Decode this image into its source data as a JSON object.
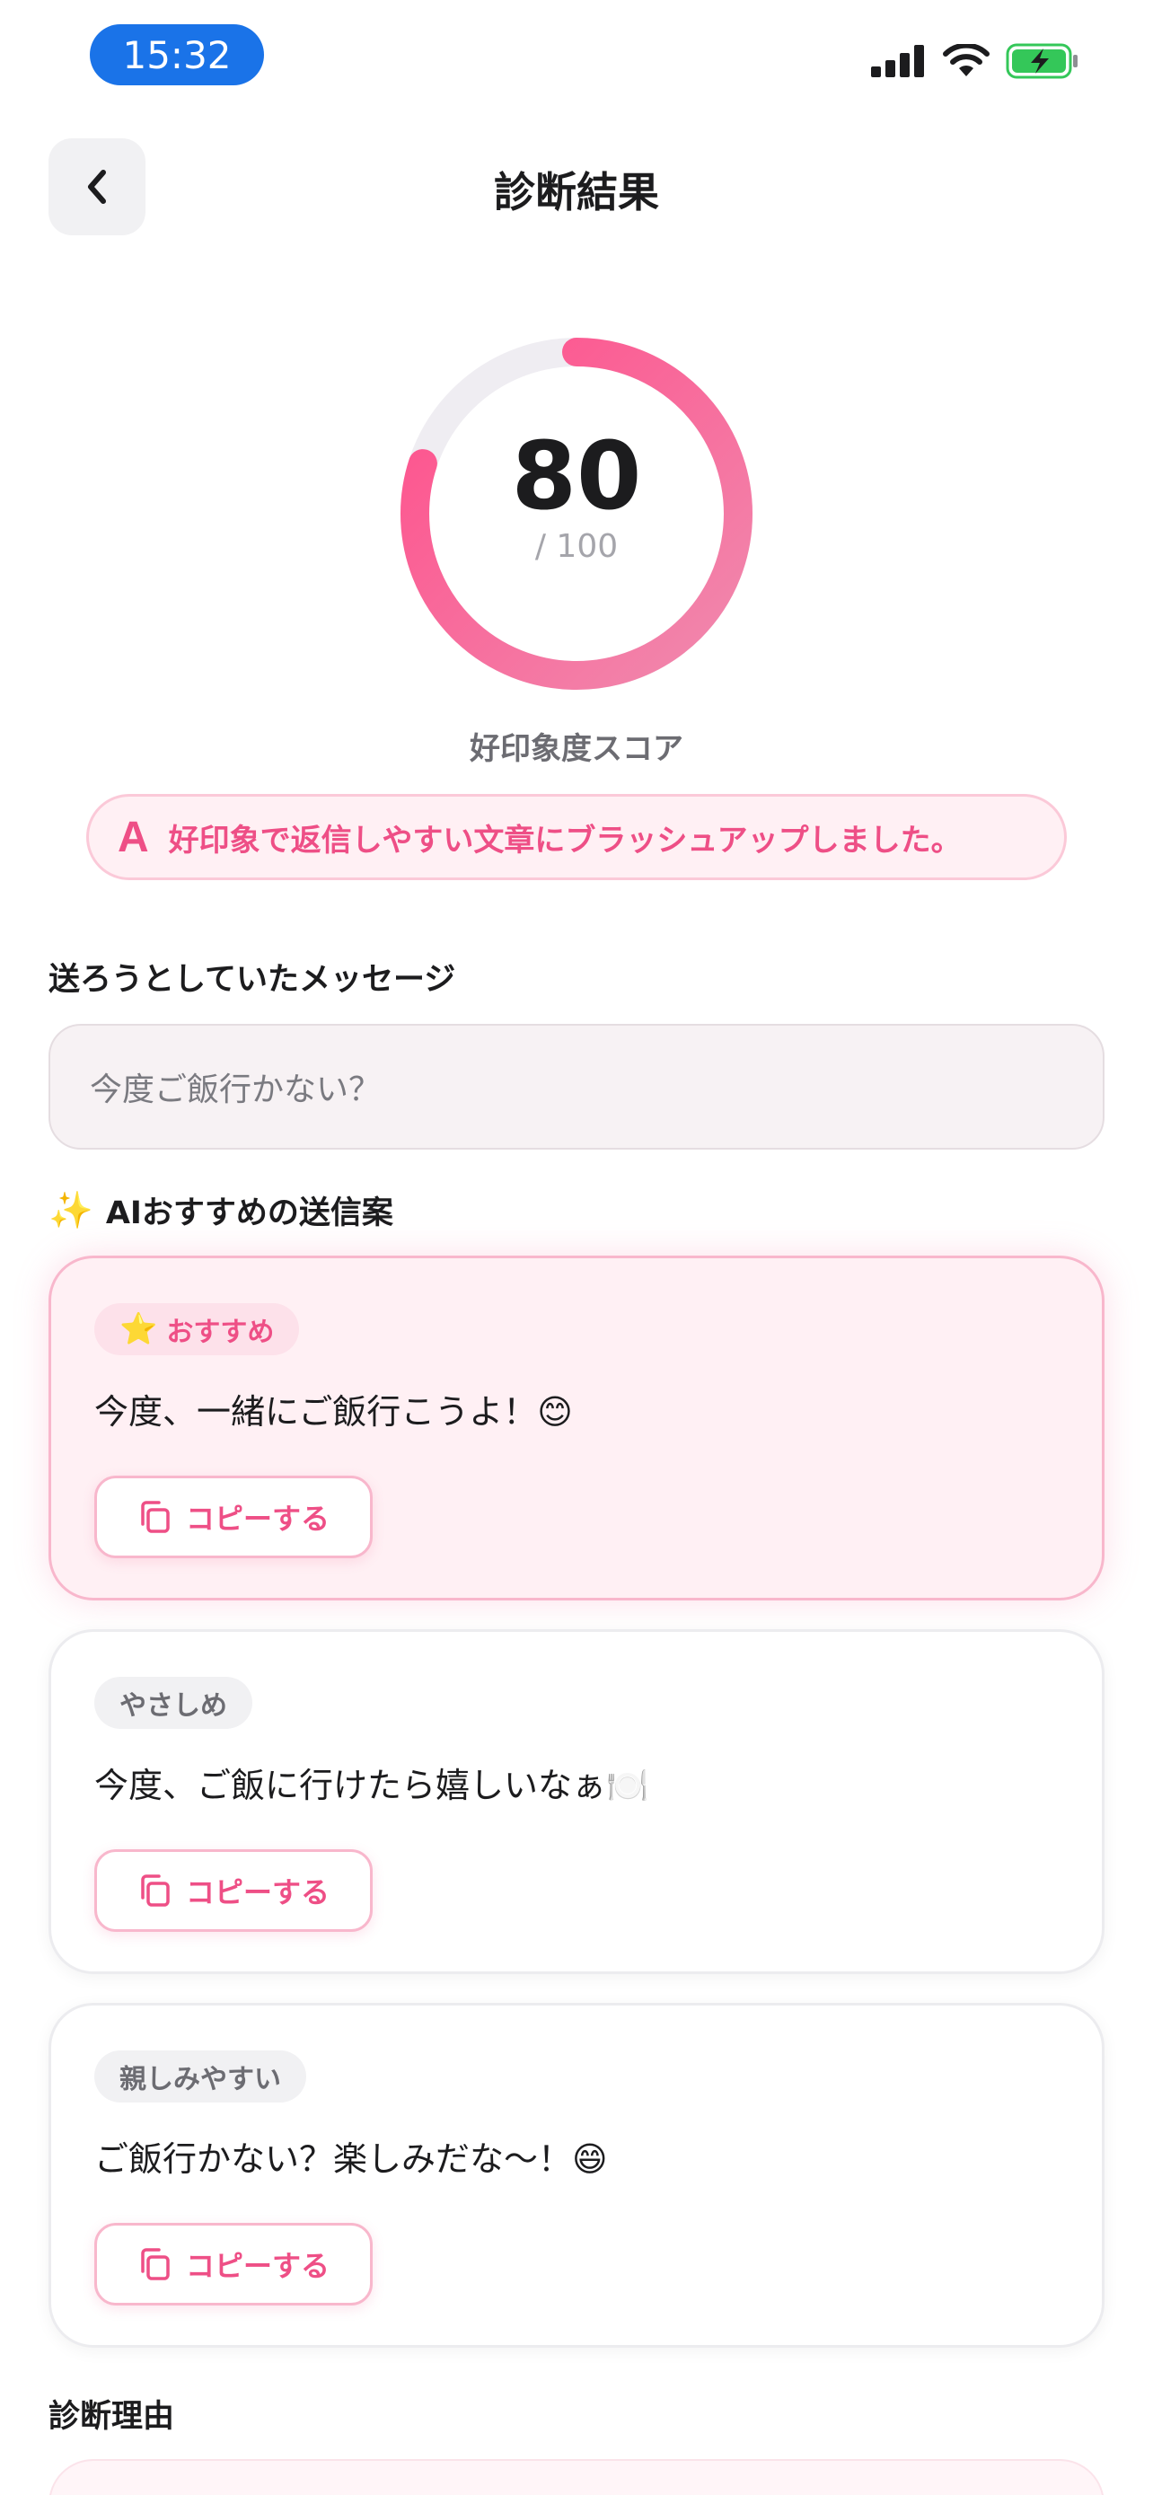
{
  "status_bar": {
    "time": "15:32"
  },
  "header": {
    "title": "診断結果"
  },
  "score": {
    "value": "80",
    "max": "/ 100",
    "label": "好印象度スコア",
    "fraction": 0.8
  },
  "banner": {
    "icon_letter": "A",
    "text": "好印象で返信しやすい文章にブラッシュアップしました。"
  },
  "original": {
    "heading": "送ろうとしていたメッセージ",
    "message": "今度ご飯行かない？"
  },
  "suggestions": {
    "heading_icon": "sparkles-icon",
    "heading": "AIおすすめの送信案",
    "items": [
      {
        "tag": "おすすめ",
        "tag_icon": "star-icon",
        "text": "今度、一緒にご飯行こうよ！😊",
        "copy_label": "コピーする"
      },
      {
        "tag": "やさしめ",
        "text": "今度、ご飯に行けたら嬉しいなぁ🍽️",
        "copy_label": "コピーする"
      },
      {
        "tag": "親しみやすい",
        "text": "ご飯行かない？楽しみだな〜！😄",
        "copy_label": "コピーする"
      }
    ]
  },
  "reason": {
    "heading": "診断理由"
  },
  "colors": {
    "accent": "#ee4f86",
    "ring_start": "#f07aa3",
    "ring_end": "#ff4f8b",
    "ring_track": "#efedf2",
    "time_pill": "#1a73e8"
  }
}
